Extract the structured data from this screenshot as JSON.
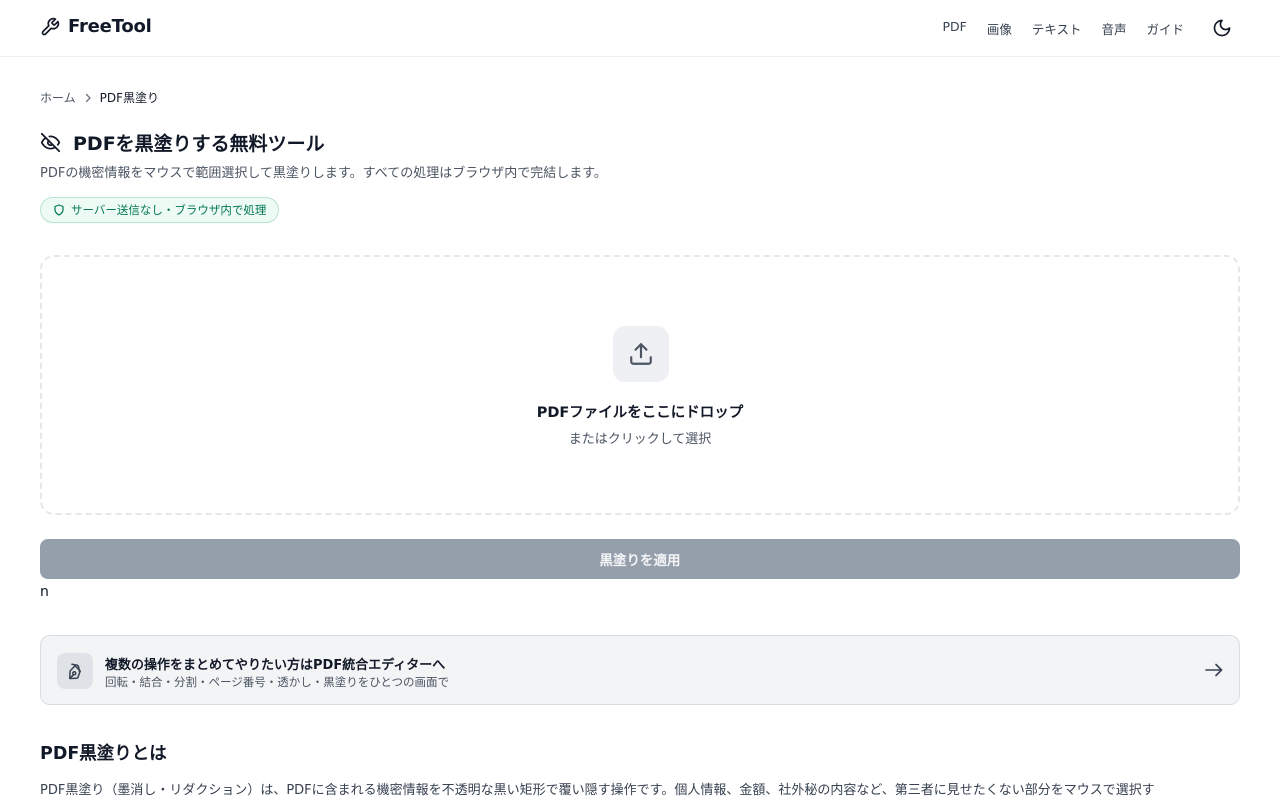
{
  "header": {
    "logo_text": "FreeTool",
    "nav": [
      "PDF",
      "画像",
      "テキスト",
      "音声",
      "ガイド"
    ]
  },
  "breadcrumb": {
    "home": "ホーム",
    "current": "PDF黒塗り"
  },
  "page": {
    "title": "PDFを黒塗りする無料ツール",
    "subtitle": "PDFの機密情報をマウスで範囲選択して黒塗りします。すべての処理はブラウザ内で完結します。",
    "privacy_badge": "サーバー送信なし・ブラウザ内で処理"
  },
  "dropzone": {
    "title": "PDFファイルをここにドロップ",
    "subtitle": "またはクリックして選択"
  },
  "apply_button": "黒塗りを適用",
  "stray_text": "n",
  "editor_card": {
    "title": "複数の操作をまとめてやりたい方はPDF統合エディターへ",
    "subtitle": "回転・結合・分割・ページ番号・透かし・黒塗りをひとつの画面で"
  },
  "about": {
    "title": "PDF黒塗りとは",
    "body": "PDF黒塗り（墨消し・リダクション）は、PDFに含まれる機密情報を不透明な黒い矩形で覆い隠す操作です。個人情報、金額、社外秘の内容など、第三者に見せたくない部分をマウスで選択す"
  },
  "colors": {
    "accent_green": "#047857",
    "badge_bg": "#eefaf4",
    "button_disabled": "#959eab"
  },
  "icons": {
    "logo": "wrench-icon",
    "theme": "moon-icon",
    "title": "eye-off-icon",
    "badge": "shield-icon",
    "upload": "upload-icon",
    "editor": "pen-tool-icon",
    "arrow": "arrow-right-icon"
  }
}
